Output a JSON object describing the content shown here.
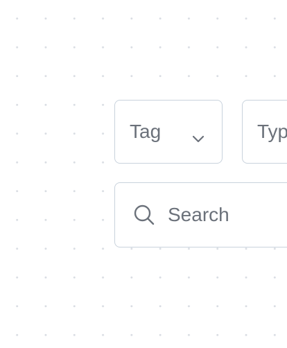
{
  "filters": {
    "tag_select": {
      "label": "Tag",
      "icon": "chevron-down-icon"
    },
    "type_select": {
      "label": "Type"
    }
  },
  "search": {
    "placeholder": "Search",
    "value": "",
    "icon": "search-icon"
  },
  "colors": {
    "border": "#c8d2dc",
    "text": "#6b717a",
    "dots": "#d9dde3",
    "background": "#ffffff"
  }
}
